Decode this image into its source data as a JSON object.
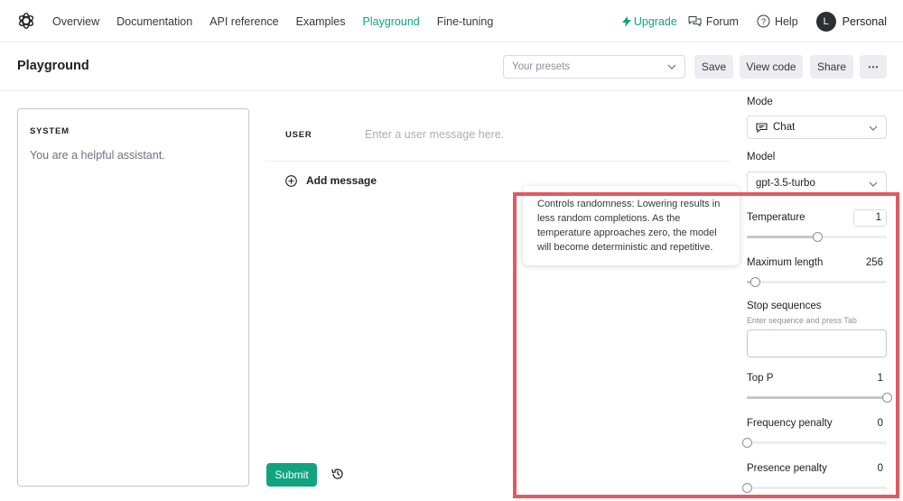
{
  "nav": {
    "links": [
      {
        "label": "Overview",
        "active": false
      },
      {
        "label": "Documentation",
        "active": false
      },
      {
        "label": "API reference",
        "active": false
      },
      {
        "label": "Examples",
        "active": false
      },
      {
        "label": "Playground",
        "active": true
      },
      {
        "label": "Fine-tuning",
        "active": false
      }
    ],
    "upgrade": "Upgrade",
    "forum": "Forum",
    "help": "Help",
    "avatar_initial": "L",
    "account": "Personal"
  },
  "header": {
    "title": "Playground",
    "presets_placeholder": "Your presets",
    "save": "Save",
    "view_code": "View code",
    "share": "Share",
    "more": "⋯"
  },
  "system": {
    "label": "SYSTEM",
    "placeholder": "You are a helpful assistant."
  },
  "chat": {
    "user_label": "USER",
    "user_placeholder": "Enter a user message here.",
    "add_message": "Add message",
    "submit": "Submit"
  },
  "tooltip": {
    "text": "Controls randomness: Lowering results in less random completions. As the temperature approaches zero, the model will become deterministic and repetitive."
  },
  "settings": {
    "mode_label": "Mode",
    "mode_value": "Chat",
    "model_label": "Model",
    "model_value": "gpt-3.5-turbo",
    "temperature_label": "Temperature",
    "temperature_value": "1",
    "temperature_level": 0.5,
    "max_length_label": "Maximum length",
    "max_length_value": "256",
    "max_length_level": 0.06,
    "stop_label": "Stop sequences",
    "stop_hint": "Enter sequence and press Tab",
    "top_p_label": "Top P",
    "top_p_value": "1",
    "top_p_level": 1.0,
    "freq_label": "Frequency penalty",
    "freq_value": "0",
    "freq_level": 0.0,
    "presence_label": "Presence penalty",
    "presence_value": "0",
    "presence_level": 0.0
  },
  "colors": {
    "accent": "#10a37f",
    "highlight": "#e05a62"
  }
}
